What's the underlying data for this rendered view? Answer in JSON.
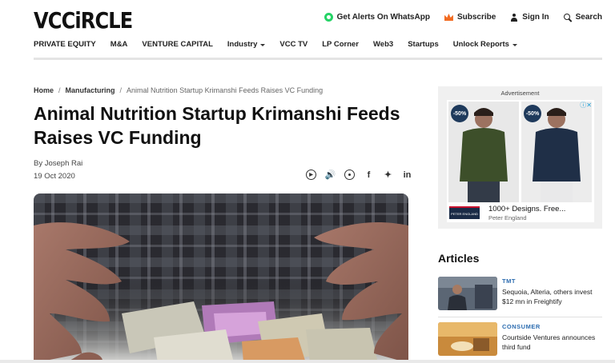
{
  "header": {
    "logo": "VCCiRCLE",
    "actions": [
      {
        "label": "Get Alerts On WhatsApp",
        "icon": "whatsapp-icon"
      },
      {
        "label": "Subscribe",
        "icon": "crown-icon"
      },
      {
        "label": "Sign In",
        "icon": "user-icon"
      },
      {
        "label": "Search",
        "icon": "search-icon"
      }
    ],
    "nav": [
      {
        "label": "PRIVATE EQUITY"
      },
      {
        "label": "M&A"
      },
      {
        "label": "VENTURE CAPITAL"
      },
      {
        "label": "Industry",
        "dropdown": true
      },
      {
        "label": "VCC TV"
      },
      {
        "label": "LP Corner"
      },
      {
        "label": "Web3"
      },
      {
        "label": "Startups"
      },
      {
        "label": "Unlock Reports",
        "dropdown": true
      }
    ]
  },
  "breadcrumb": [
    "Home",
    "Manufacturing",
    "Animal Nutrition Startup Krimanshi Feeds Raises VC Funding"
  ],
  "article": {
    "title": "Animal Nutrition Startup Krimanshi Feeds Raises VC Funding",
    "byline": "By Joseph Rai",
    "date": "19 Oct 2020",
    "share_icons": [
      "listen-icon",
      "speaker-icon",
      "whatsapp-icon",
      "facebook-icon",
      "twitter-icon",
      "linkedin-icon"
    ]
  },
  "ad": {
    "label": "Advertisement",
    "badge": "-50%",
    "text": "1000+ Designs. Free...",
    "advertiser": "Peter England",
    "brand_mark": "PETER ENGLAND"
  },
  "sidebar": {
    "title": "Articles",
    "items": [
      {
        "category": "TMT",
        "headline": "Sequoia, Alteria, others invest $12 mn in Freightify"
      },
      {
        "category": "CONSUMER",
        "headline": "Courtside Ventures announces third fund"
      }
    ]
  },
  "colors": {
    "accent_blue": "#2c6cb0",
    "whatsapp_green": "#25d366",
    "subscribe_orange": "#f26b21"
  }
}
